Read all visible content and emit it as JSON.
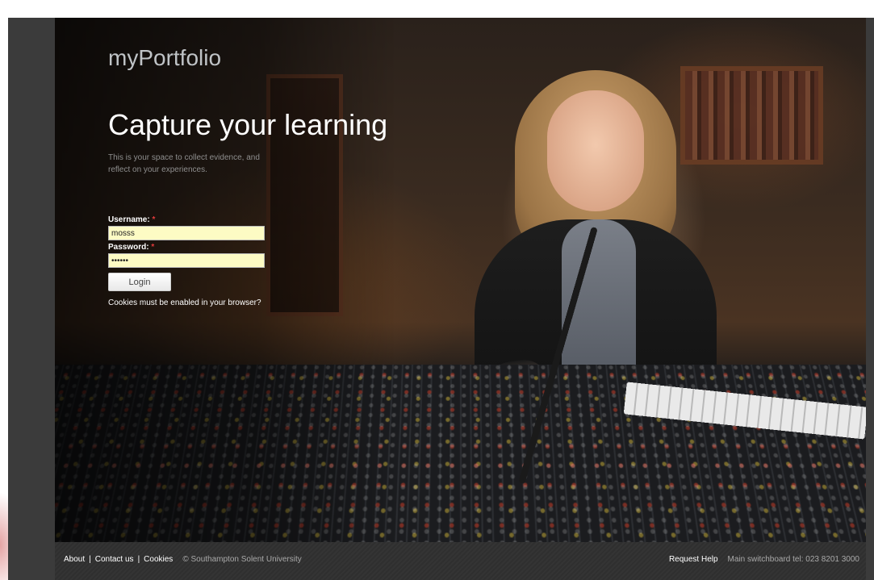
{
  "header": {
    "brand": "myPortfolio",
    "headline": "Capture your learning",
    "tagline": "This is your space to collect evidence, and reflect on your experiences."
  },
  "login": {
    "username_label": "Username:",
    "username_value": "mosss",
    "password_label": "Password:",
    "password_value": "mosss1",
    "required_marker": "*",
    "submit_label": "Login",
    "cookies_note": "Cookies must be enabled in your browser?"
  },
  "footer": {
    "links": {
      "about": "About",
      "contact": "Contact us",
      "cookies": "Cookies"
    },
    "separator": "|",
    "copyright": "© Southampton Solent University",
    "request_help": "Request Help",
    "switchboard": "Main switchboard tel: 023 8201 3000"
  },
  "colors": {
    "input_background": "#fdfbc4",
    "required_marker": "#e23b3b",
    "frame": "#3b3b3b"
  }
}
